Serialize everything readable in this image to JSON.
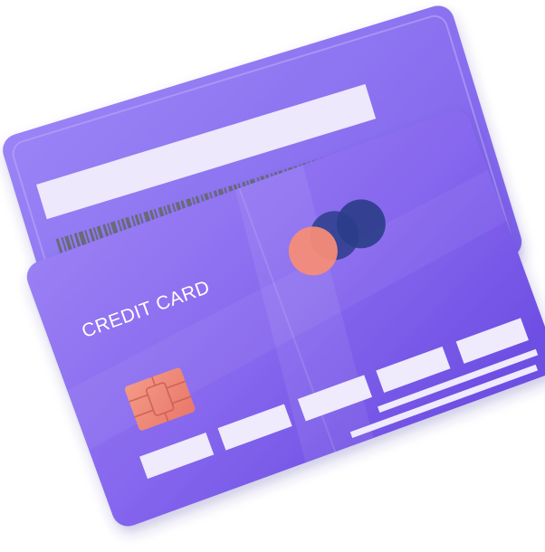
{
  "front_card": {
    "label": "CREDIT CARD",
    "label_color": "#ffffff",
    "body_color": "#8a6af0",
    "chip_color": "#f08a78",
    "logo_left_color": "#f48c78",
    "logo_right_color": "#2c3e8a",
    "field_color": "#efeafc"
  },
  "back_card": {
    "body_color": "#8c72f2",
    "signature_strip_color": "#ede8fc",
    "barcode_color": "#6a6a78"
  }
}
